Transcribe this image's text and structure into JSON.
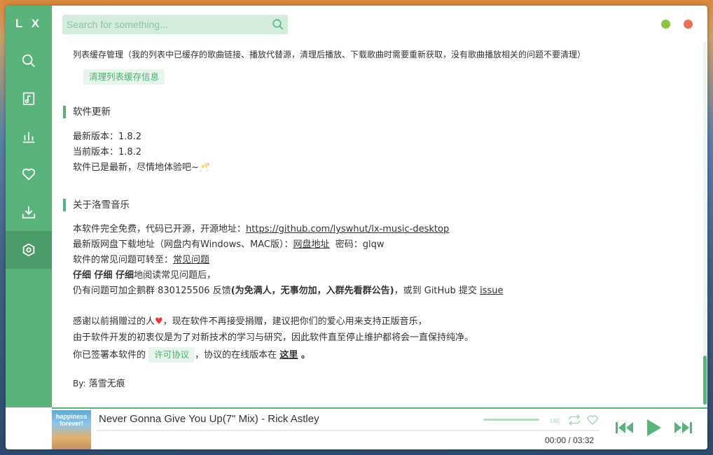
{
  "sidebar": {
    "logo": "L X",
    "items": [
      {
        "name": "search",
        "icon": "search-icon"
      },
      {
        "name": "songlist",
        "icon": "music-file-icon"
      },
      {
        "name": "leaderboard",
        "icon": "bar-chart-icon"
      },
      {
        "name": "my-list",
        "icon": "heart-icon"
      },
      {
        "name": "download",
        "icon": "download-icon"
      },
      {
        "name": "settings",
        "icon": "settings-icon",
        "active": true
      }
    ]
  },
  "search": {
    "placeholder": "Search for something..."
  },
  "colors": {
    "accent": "#5ab37a",
    "accent_dark": "#4a9b67",
    "minimize": "#8bc34a",
    "close": "#e57558"
  },
  "content": {
    "cache_desc": "列表缓存管理（我的列表中已缓存的歌曲链接、播放代替源，清理后播放、下载歌曲时需要重新获取，没有歌曲播放相关的问题不要清理）",
    "cache_button": "清理列表缓存信息",
    "update_title": "软件更新",
    "latest_version": "最新版本：1.8.2",
    "current_version": "当前版本：1.8.2",
    "update_status": "软件已是最新，尽情地体验吧~🥂",
    "about_title": "关于洛雪音乐",
    "about_line1_prefix": "本软件完全免费，代码已开源，开源地址：",
    "about_line1_link": "https://github.com/lyswhut/lx-music-desktop",
    "about_line2_prefix": "最新版网盘下载地址（网盘内有Windows、MAC版）：",
    "about_line2_link": "网盘地址",
    "about_line2_suffix": "密码：glqw",
    "about_line3_prefix": "软件的常见问题可转至：",
    "about_line3_link": "常见问题",
    "about_line4_bold": "仔细 仔细 仔细",
    "about_line4_suffix": "地阅读常见问题后，",
    "about_line5_prefix": "仍有问题可加企鹅群 830125506 反馈",
    "about_line5_bold": "(为免满人，无事勿加，入群先看群公告)",
    "about_line5_mid": "，或到 GitHub 提交 ",
    "about_line5_link": "issue",
    "thanks_line1_prefix": "感谢以前捐赠过的人",
    "thanks_line1_heart": "♥",
    "thanks_line1_suffix": "，现在软件不再接受捐赠，建议把你们的爱心用来支持正版音乐，",
    "thanks_line2": "由于软件开发的初衷仅是为了对新技术的学习与研究，因此软件直至停止维护都将会一直保持纯净。",
    "license_prefix": "你已签署本软件的",
    "license_button": "许可协议",
    "license_mid": "，协议的在线版本在 ",
    "license_link": "这里",
    "license_suffix": " 。",
    "by_label": "By:",
    "by_name": "落雪无痕"
  },
  "player": {
    "cover_text": "happiness forever!",
    "title": "Never Gonna Give You Up(7\" Mix) - Rick Astley",
    "current_time": "00:00",
    "separator": "/",
    "total_time": "03:32",
    "progress": 0,
    "volume": 1,
    "lrc_label": "LRC"
  }
}
